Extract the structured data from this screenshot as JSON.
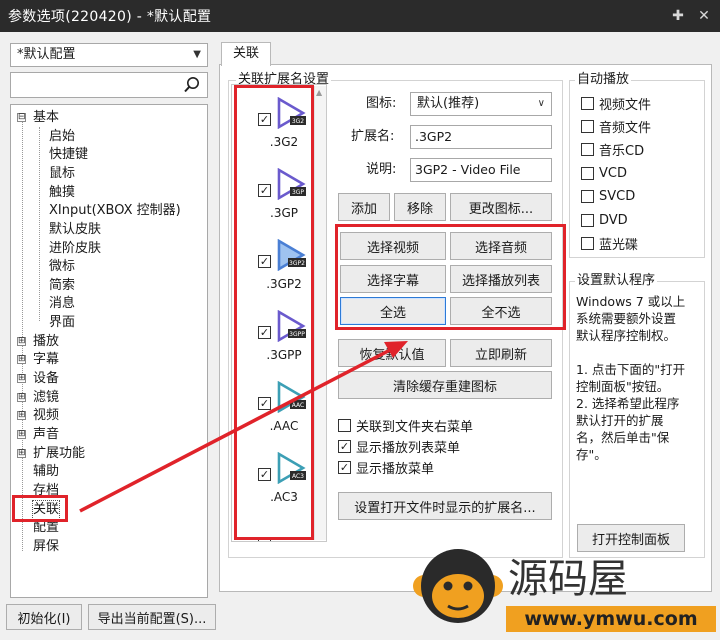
{
  "window": {
    "title": "参数选项(220420) - *默认配置"
  },
  "left": {
    "profile_select": "*默认配置",
    "search": {
      "value": ""
    },
    "tree": [
      {
        "label": "基本",
        "expander": "⊟"
      },
      {
        "label": "启始"
      },
      {
        "label": "快捷键"
      },
      {
        "label": "鼠标"
      },
      {
        "label": "触摸"
      },
      {
        "label": "XInput(XBOX 控制器)"
      },
      {
        "label": "默认皮肤"
      },
      {
        "label": "进阶皮肤"
      },
      {
        "label": "微标"
      },
      {
        "label": "简索"
      },
      {
        "label": "消息"
      },
      {
        "label": "界面"
      },
      {
        "label": "播放",
        "expander": "⊞"
      },
      {
        "label": "字幕",
        "expander": "⊞"
      },
      {
        "label": "设备",
        "expander": "⊞"
      },
      {
        "label": "滤镜",
        "expander": "⊞"
      },
      {
        "label": "视频",
        "expander": "⊞"
      },
      {
        "label": "声音",
        "expander": "⊞"
      },
      {
        "label": "扩展功能",
        "expander": "⊞"
      },
      {
        "label": "辅助"
      },
      {
        "label": "存档"
      },
      {
        "label": "关联"
      },
      {
        "label": "配置"
      },
      {
        "label": "屏保"
      }
    ]
  },
  "tab": {
    "label": "关联"
  },
  "ext_group": {
    "title": "关联扩展名设置",
    "items": [
      {
        "name": ".3G2",
        "badge": "3G2",
        "color": "#6a5acd",
        "checked": "✓"
      },
      {
        "name": ".3GP",
        "badge": "3GP",
        "color": "#6a5acd",
        "checked": "✓"
      },
      {
        "name": ".3GP2",
        "badge": "3GP2",
        "color": "#4a7fd4",
        "checked": "✓"
      },
      {
        "name": ".3GPP",
        "badge": "3GPP",
        "color": "#6a5acd",
        "checked": "✓"
      },
      {
        "name": ".AAC",
        "badge": "AAC",
        "color": "#3c9fb5",
        "checked": "✓"
      },
      {
        "name": ".AC3",
        "badge": "AC3",
        "color": "#3c9fb5",
        "checked": "✓"
      }
    ],
    "icon_label": "图标:",
    "icon_value": "默认(推荐)",
    "ext_label": "扩展名:",
    "ext_value": ".3GP2",
    "desc_label": "说明:",
    "desc_value": "3GP2 - Video File",
    "btn_add": "添加",
    "btn_remove": "移除",
    "btn_change_icon": "更改图标...",
    "btn_sel_video": "选择视频",
    "btn_sel_audio": "选择音频",
    "btn_sel_sub": "选择字幕",
    "btn_sel_playlist": "选择播放列表",
    "btn_sel_all": "全选",
    "btn_sel_none": "全不选",
    "btn_restore": "恢复默认值",
    "btn_refresh": "立即刷新",
    "btn_clear_cache": "清除缓存重建图标",
    "chk_folder": {
      "label": "关联到文件夹右菜单",
      "mark": ""
    },
    "chk_playlist_menu": {
      "label": "显示播放列表菜单",
      "mark": "✓"
    },
    "chk_play_menu": {
      "label": "显示播放菜单",
      "mark": "✓"
    },
    "btn_open_ext": "设置打开文件时显示的扩展名..."
  },
  "autoplay": {
    "title": "自动播放",
    "items": [
      {
        "label": "视频文件"
      },
      {
        "label": "音频文件"
      },
      {
        "label": "音乐CD"
      },
      {
        "label": "VCD"
      },
      {
        "label": "SVCD"
      },
      {
        "label": "DVD"
      },
      {
        "label": "蓝光碟"
      }
    ]
  },
  "default_program": {
    "title": "设置默认程序",
    "text": "Windows 7 或以上\n系统需要额外设置\n默认程序控制权。\n\n1. 点击下面的\"打开\n控制面板\"按钮。\n2. 选择希望此程序\n默认打开的扩展\n名，然后单击\"保\n存\"。",
    "btn_open_panel": "打开控制面板"
  },
  "bottom": {
    "btn_init": "初始化(I)",
    "btn_export": "导出当前配置(S)..."
  },
  "watermark": {
    "brand": "源码屋",
    "url": "www.ymwu.com"
  },
  "colors": {
    "annotation_red": "#e0232a",
    "titlebar": "#2b2b2b"
  }
}
